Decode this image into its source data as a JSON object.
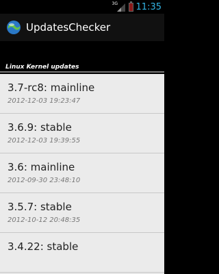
{
  "status_bar": {
    "signal_tag": "3G",
    "signal_icon": "signal-icon",
    "battery_icon": "battery-icon",
    "battery_color": "#8b1a1a",
    "time": "11:35",
    "time_color": "#33b5e5"
  },
  "action_bar": {
    "title": "UpdatesChecker",
    "app_icon": "app-icon"
  },
  "section": {
    "header": "Linux Kernel updates"
  },
  "updates": [
    {
      "title": "3.7-rc8: mainline",
      "date": "2012-12-03 19:23:47"
    },
    {
      "title": "3.6.9: stable",
      "date": "2012-12-03 19:39:55"
    },
    {
      "title": "3.6: mainline",
      "date": "2012-09-30 23:48:10"
    },
    {
      "title": "3.5.7: stable",
      "date": "2012-10-12 20:48:35"
    },
    {
      "title": "3.4.22: stable",
      "date": ""
    }
  ]
}
